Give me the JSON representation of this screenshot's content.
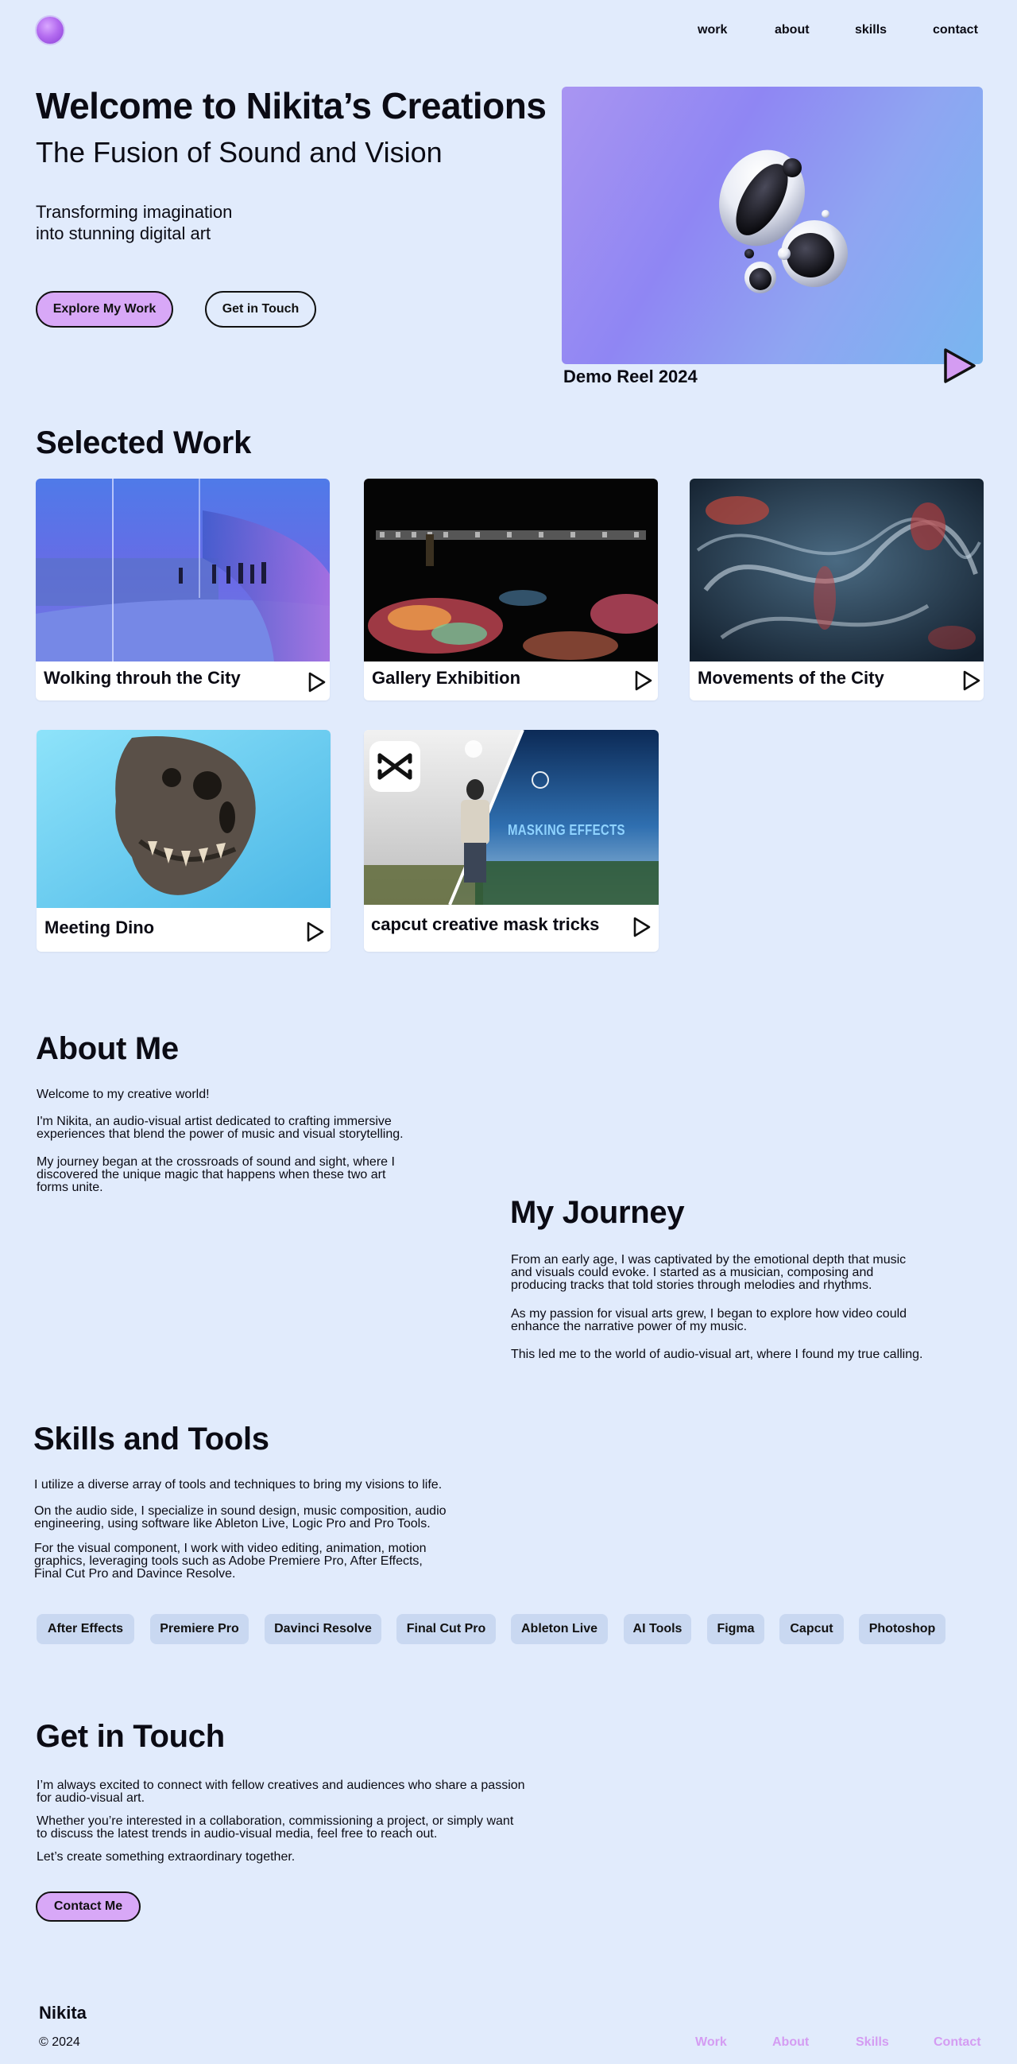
{
  "nav": {
    "items": [
      "work",
      "about",
      "skills",
      "contact"
    ]
  },
  "hero": {
    "title": "Welcome to Nikita’s Creations",
    "subtitle": "The Fusion of Sound and Vision",
    "lead": "Transforming imagination\ninto stunning digital art",
    "primary_button": "Explore My Work",
    "secondary_button": "Get in Touch",
    "reel_title": "Demo Reel 2024"
  },
  "work": {
    "title": "Selected Work",
    "items": [
      "Wolking throuh the City",
      "Gallery Exhibition",
      "Movements of the City",
      "Meeting Dino",
      "capcut creative mask tricks"
    ],
    "capcut_overlay": "MASKING EFFECTS"
  },
  "about": {
    "title": "About Me",
    "p1": "Welcome to my creative world!",
    "p2": "I'm Nikita, an audio-visual artist dedicated to crafting immersive\nexperiences that blend the power of music and visual storytelling.",
    "p3": "My journey began at the crossroads of sound and sight, where I\ndiscovered the unique magic that happens when these two art\nforms unite."
  },
  "journey": {
    "title": "My Journey",
    "p1": "From an early age, I was captivated by the emotional depth that music\nand visuals could evoke. I started as a musician, composing and\nproducing tracks that told stories through melodies and rhythms.",
    "p2": "As my passion for visual arts grew, I began to explore how video could\nenhance the narrative power of my music.",
    "p3": "This led me to the world of audio-visual art, where I found my true calling."
  },
  "skills": {
    "title": "Skills and Tools",
    "p1": "I utilize a diverse array of tools and techniques to bring my visions to life.",
    "p2": "On the audio side, I specialize in sound design, music composition, audio\nengineering, using software like Ableton Live, Logic Pro and Pro Tools.",
    "p3": "For the visual component, I work with video editing, animation, motion\ngraphics, leveraging tools such as Adobe Premiere Pro, After Effects,\nFinal Cut Pro and Davince Resolve.",
    "chips": [
      "After Effects",
      "Premiere Pro",
      "Davinci Resolve",
      "Final Cut Pro",
      "Ableton Live",
      "AI Tools",
      "Figma",
      "Capcut",
      "Photoshop"
    ]
  },
  "contact": {
    "title": "Get in Touch",
    "p1": "I’m always excited to connect with fellow creatives and audiences who share a passion\nfor audio-visual art.",
    "p2": "Whether you’re interested in a  collaboration, commissioning a project, or simply want\nto discuss the latest trends in audio-visual media, feel free to reach out.",
    "p3": "Let’s create something extraordinary together.",
    "button": "Contact Me"
  },
  "footer": {
    "name": "Nikita",
    "copyright": "© 2024",
    "links": [
      "Work",
      "About",
      "Skills",
      "Contact"
    ]
  },
  "colors": {
    "background": "#e1ebfc",
    "accent": "#d8a8f7",
    "chip": "#c9d8f1",
    "footer_link": "#d49cf2"
  }
}
